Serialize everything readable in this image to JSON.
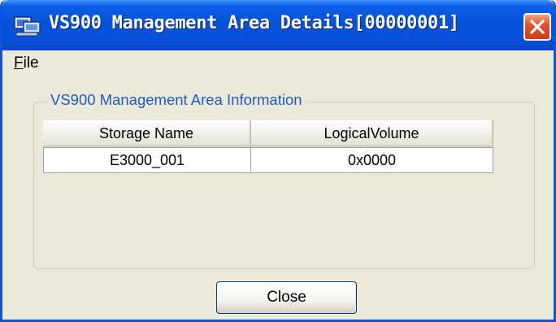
{
  "window": {
    "title": "VS900 Management Area Details[00000001]",
    "app_icon": "network-computer-icon",
    "close_icon": "close-icon"
  },
  "menu": {
    "items": [
      {
        "accel": "F",
        "rest": "ile"
      }
    ]
  },
  "group": {
    "label": "VS900 Management Area Information"
  },
  "table": {
    "columns": [
      "Storage Name",
      "LogicalVolume"
    ],
    "rows": [
      [
        "E3000_001",
        "0x0000"
      ]
    ]
  },
  "buttons": {
    "close_label": "Close"
  },
  "colors": {
    "titlebar": "#0552d8",
    "close_button": "#d23c16",
    "group_label": "#1d5cc8",
    "dialog_bg": "#ece9d8"
  }
}
